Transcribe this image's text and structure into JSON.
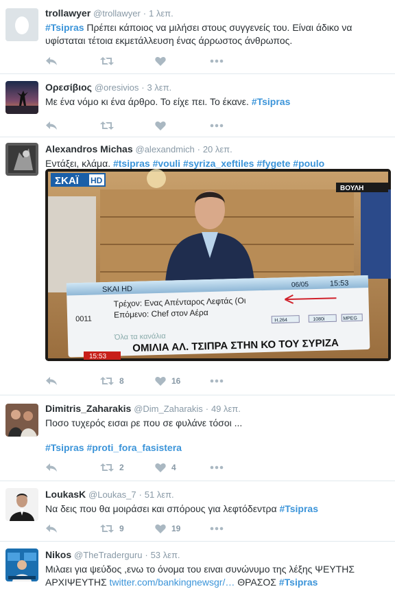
{
  "tweets": [
    {
      "name": "trollawyer",
      "handle": "@trollawyer",
      "time": "1 λεπ.",
      "tag": "#Tsipras",
      "text": " Πρέπει κάποιος να μιλήσει στους συγγενείς του. Είναι άδικο να υφίσταται τέτοια εκμετάλλευση ένας άρρωστος άνθρωπος."
    },
    {
      "name": "Ορεσίβιος",
      "handle": "@oresivios",
      "time": "3 λεπ.",
      "text": "Με ένα νόμο κι ένα άρθρο. Το είχε πει. Το έκανε. ",
      "tag": "#Tsipras"
    },
    {
      "name": "Alexandros Michas",
      "handle": "@alexandmich",
      "time": "20 λεπ.",
      "text": "Εντάξει, κλάμα. ",
      "tags": [
        "#tsipras",
        "#vouli",
        "#syriza_xeftiles",
        "#fygete",
        "#poulo"
      ],
      "retweets": "8",
      "likes": "16",
      "media": {
        "channel_logo": "ΣΚΑΪ",
        "channel_hd": "HD",
        "corner_label": "ΒΟΥΛΗ",
        "epg_channel": "SKAI HD",
        "epg_date": "06/05",
        "epg_time": "15:53",
        "epg_now": "Τρέχον: Ενας Απένταρος Λεφτάς (Οι",
        "epg_next": "Επόμενο: Chef στον Αέρα",
        "epg_number": "0011",
        "epg_all": "Όλα τα κανάλια",
        "chip1": "H.264",
        "chip2": "1080i",
        "chip3": "MPEG",
        "ticker": "ΟΜΙΛΙΑ ΑΛ. ΤΣΙΠΡΑ ΣΤΗΝ ΚΟ ΤΟΥ ΣΥΡΙΖΑ",
        "clock": "15:53"
      }
    },
    {
      "name": "Dimitris_Zaharakis",
      "handle": "@Dim_Zaharakis",
      "time": "49 λεπ.",
      "text": "Ποσο τυχερός εισαι ρε που σε φυλάνε τόσοι ...",
      "tags": [
        "#Tsipras",
        "#proti_fora_fasistera"
      ],
      "retweets": "2",
      "likes": "4"
    },
    {
      "name": "LoukasK",
      "handle": "@Loukas_7",
      "time": "51 λεπ.",
      "text": "Να δεις που θα μοιράσει και σπόρους για λεφτόδεντρα ",
      "tag": "#Tsipras",
      "retweets": "9",
      "likes": "19"
    },
    {
      "name": "Nikos",
      "handle": "@TheTraderguru",
      "time": "53 λεπ.",
      "text1": "Μιλαει για ψεύδος ,ενω το όνομα του ειναι συνώνυμο της λέξης ΨΕΥΤΗΣ",
      "text2a": "ΑΡΧΙΨΕΥΤΗΣ ",
      "link": "twitter.com/bankingnewsgr/…",
      "text2b": " ΘΡΑΣΟΣ ",
      "tag": "#Tsipras"
    }
  ],
  "colors": {
    "accent": "#3b94d9",
    "muted": "#8899a6",
    "text": "#292f33",
    "divider": "#e1e8ed"
  },
  "icons": [
    "reply-icon",
    "retweet-icon",
    "like-icon",
    "more-icon"
  ]
}
